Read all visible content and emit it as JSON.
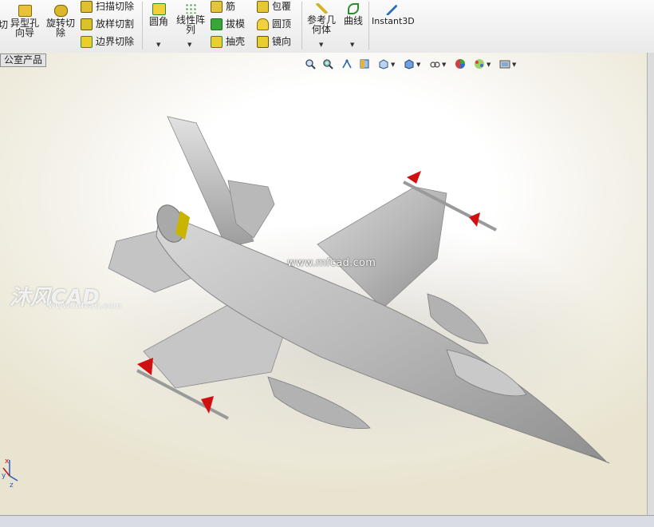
{
  "ribbon": {
    "hole_wizard_line1": "异型孔",
    "hole_wizard_line2": "向导",
    "revolved_cut_line1": "旋转切",
    "revolved_cut_line2": "除",
    "swept_cut": "扫描切除",
    "lofted_cut": "放样切割",
    "boundary_cut": "边界切除",
    "fillet": "圆角",
    "linear_pattern_line1": "线性阵",
    "linear_pattern_line2": "列",
    "rib": "筋",
    "draft": "拔模",
    "shell": "抽壳",
    "wrap": "包覆",
    "dome": "圆顶",
    "mirror": "镜向",
    "ref_geometry_line1": "参考几",
    "ref_geometry_line2": "何体",
    "curves": "曲线",
    "instant3d": "Instant3D"
  },
  "tab": {
    "label": "公室产品"
  },
  "hud_icons": [
    "zoom-to-fit-icon",
    "zoom-area-icon",
    "previous-view-icon",
    "section-view-icon",
    "view-orientation-icon",
    "display-style-icon",
    "hide-show-icon",
    "edit-appearance-icon",
    "apply-scene-icon",
    "view-settings-icon"
  ],
  "watermark": {
    "url": "www.mfcad.com",
    "logo": "沐风CAD",
    "logo_sub": "www.mfcad.com"
  },
  "triad": {
    "x": "x",
    "y": "y",
    "z": "z"
  },
  "colors": {
    "accent_red": "#d01010",
    "model_gray": "#b5b5b5",
    "ring_yellow": "#c9b400"
  }
}
